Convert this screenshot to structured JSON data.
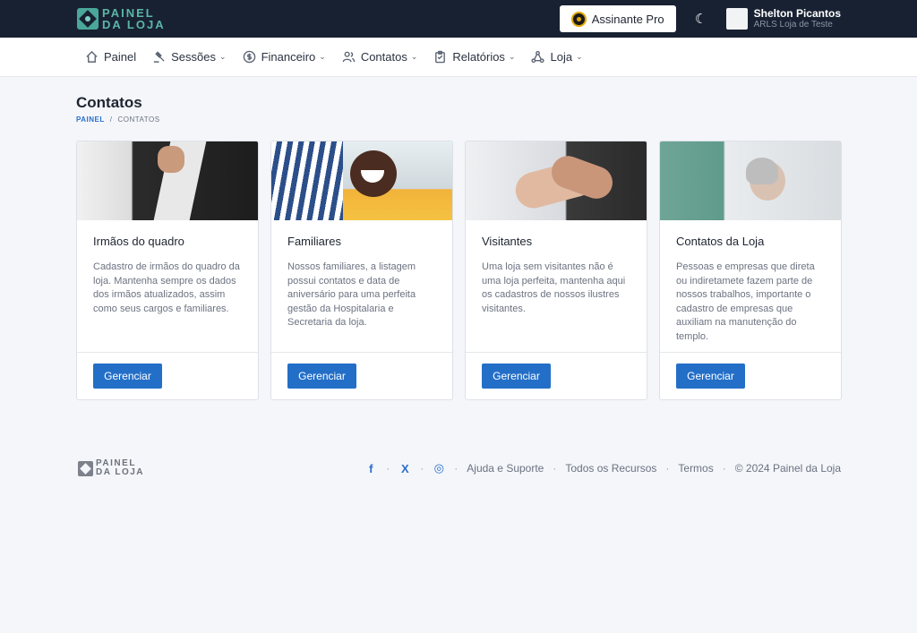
{
  "header": {
    "logo_line1": "PAINEL",
    "logo_line2": "DA LOJA",
    "pro_label": "Assinante Pro",
    "user_name": "Shelton Picantos",
    "user_org": "ARLS Loja de Teste"
  },
  "nav": {
    "items": [
      {
        "label": "Painel",
        "icon": "home-icon"
      },
      {
        "label": "Sessões",
        "icon": "gavel-icon"
      },
      {
        "label": "Financeiro",
        "icon": "dollar-icon"
      },
      {
        "label": "Contatos",
        "icon": "users-icon"
      },
      {
        "label": "Relatórios",
        "icon": "clipboard-icon"
      },
      {
        "label": "Loja",
        "icon": "network-icon"
      }
    ]
  },
  "page": {
    "title": "Contatos",
    "breadcrumb_root": "PAINEL",
    "breadcrumb_sep": "/",
    "breadcrumb_current": "CONTATOS"
  },
  "cards": [
    {
      "title": "Irmãos do quadro",
      "text": "Cadastro de irmãos do quadro da loja. Mantenha sempre os dados dos irmãos atualizados, assim como seus cargos e familiares.",
      "button": "Gerenciar"
    },
    {
      "title": "Familiares",
      "text": "Nossos familiares, a listagem possui contatos e data de aniversário para uma perfeita gestão da Hospitalaria e Secretaria da loja.",
      "button": "Gerenciar"
    },
    {
      "title": "Visitantes",
      "text": "Uma loja sem visitantes não é uma loja perfeita, mantenha aqui os cadastros de nossos ilustres visitantes.",
      "button": "Gerenciar"
    },
    {
      "title": "Contatos da Loja",
      "text": "Pessoas e empresas que direta ou indiretamete fazem parte de nossos trabalhos, importante o cadastro de empresas que auxiliam na manutenção do templo.",
      "button": "Gerenciar"
    }
  ],
  "footer": {
    "logo_line1": "PAINEL",
    "logo_line2": "DA LOJA",
    "social": {
      "facebook": "f",
      "x": "X",
      "instagram": "◎"
    },
    "links": [
      "Ajuda e Suporte",
      "Todos os Recursos",
      "Termos"
    ],
    "copyright": "© 2024 Painel da Loja"
  },
  "colors": {
    "topbar": "#182132",
    "accent": "#236fc7",
    "logo": "#5bb6a8"
  }
}
